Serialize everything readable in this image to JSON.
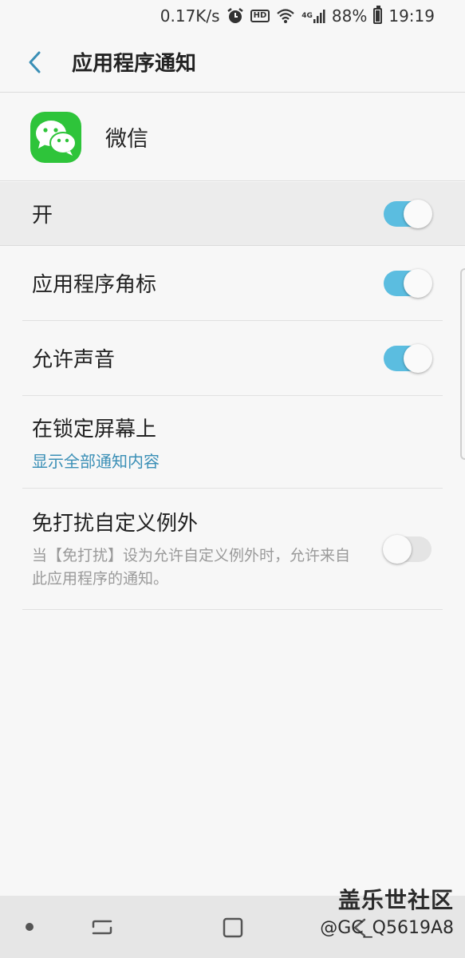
{
  "status_bar": {
    "network_speed": "0.17K/s",
    "hd_label": "HD",
    "network_type": "4G",
    "battery": "88%",
    "time": "19:19"
  },
  "header": {
    "title": "应用程序通知"
  },
  "app": {
    "name": "微信",
    "icon": "wechat-icon",
    "icon_color": "#2ec43a"
  },
  "main_toggle": {
    "label": "开",
    "on": true
  },
  "settings": [
    {
      "title": "应用程序角标",
      "on": true
    },
    {
      "title": "允许声音",
      "on": true
    },
    {
      "title": "在锁定屏幕上",
      "subtitle": "显示全部通知内容"
    },
    {
      "title": "免打扰自定义例外",
      "description": "当【免打扰】设为允许自定义例外时，允许来自此应用程序的通知。",
      "on": false
    }
  ],
  "colors": {
    "accent": "#5bbde0",
    "link": "#3a8fb6",
    "background": "#f7f7f7"
  },
  "watermark": {
    "title": "盖乐世社区",
    "handle": "@GC_Q5619A8"
  }
}
